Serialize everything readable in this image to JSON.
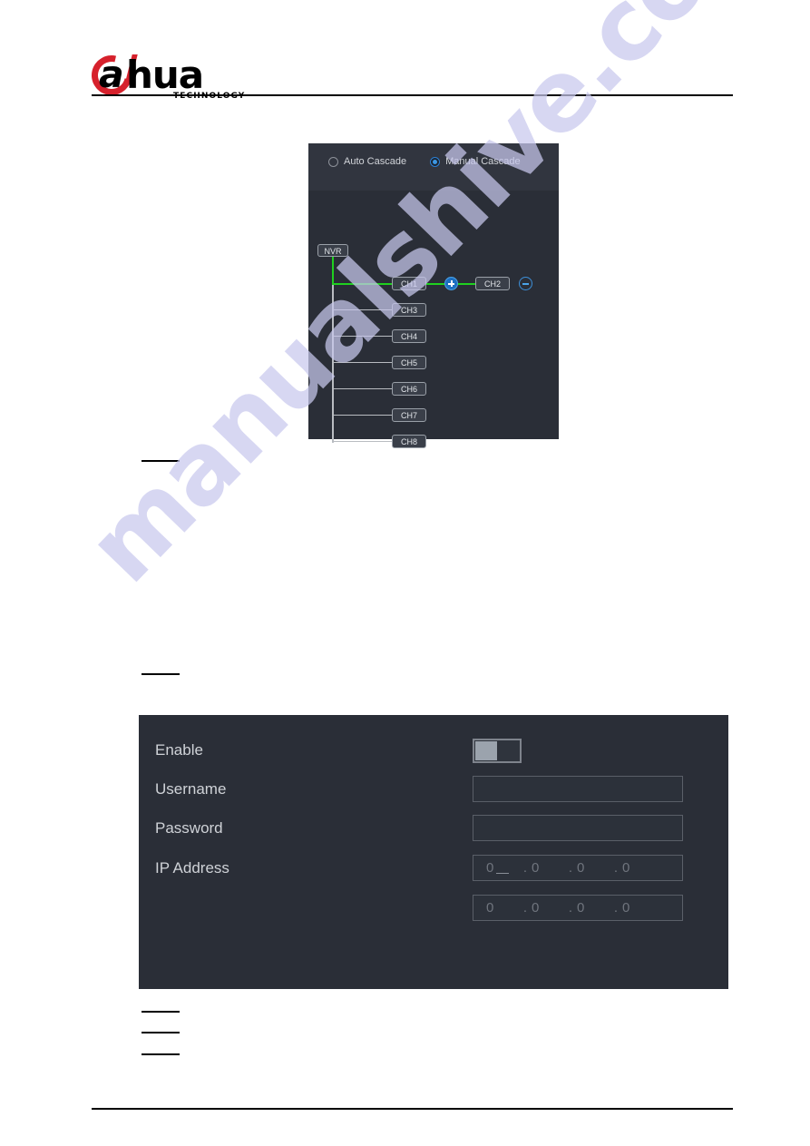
{
  "brand": {
    "name": "alhua",
    "letter": "a",
    "word": "hua",
    "tagline": "TECHNOLOGY"
  },
  "watermark": {
    "text": "manualshive.com",
    "color": "#c9c9ee"
  },
  "cascade_panel": {
    "mode_options": [
      {
        "label": "Auto Cascade",
        "selected": false
      },
      {
        "label": "Manual Cascade",
        "selected": true
      }
    ],
    "root_node": "NVR",
    "channels": [
      {
        "label": "CH1",
        "active": true
      },
      {
        "label": "CH3",
        "active": false
      },
      {
        "label": "CH4",
        "active": false
      },
      {
        "label": "CH5",
        "active": false
      },
      {
        "label": "CH6",
        "active": false
      },
      {
        "label": "CH7",
        "active": false
      },
      {
        "label": "CH8",
        "active": false
      }
    ],
    "cascaded_node": "CH2",
    "add_button": "+",
    "remove_button": "-",
    "active_link_color": "#1fd01f",
    "accent_color": "#1d6fc0"
  },
  "form_panel": {
    "rows": [
      {
        "label": "Enable",
        "type": "toggle",
        "value": "off"
      },
      {
        "label": "Username",
        "type": "text",
        "value": ""
      },
      {
        "label": "Password",
        "type": "password",
        "value": ""
      },
      {
        "label": "IP Address",
        "type": "ip",
        "value": [
          "0",
          "0",
          "0",
          "0"
        ]
      }
    ],
    "ip_secondary": [
      "0",
      "0",
      "0",
      "0"
    ],
    "ip_separator": "."
  }
}
